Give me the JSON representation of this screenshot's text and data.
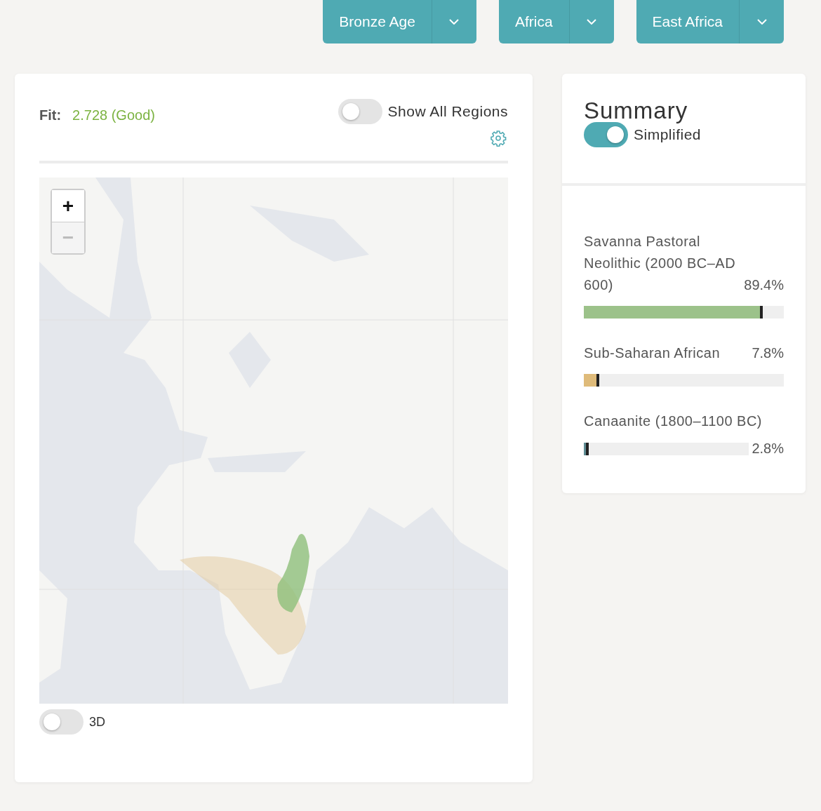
{
  "filters": [
    {
      "label": "Bronze Age"
    },
    {
      "label": "Africa"
    },
    {
      "label": "East Africa"
    }
  ],
  "fit": {
    "label": "Fit:",
    "value": "2.728 (Good)"
  },
  "show_all_regions": {
    "label": "Show All Regions",
    "on": false
  },
  "map": {
    "zoom_in": {
      "label": "+",
      "disabled": false
    },
    "zoom_out": {
      "label": "−",
      "disabled": true
    }
  },
  "toggle_3d": {
    "label": "3D",
    "on": false
  },
  "summary": {
    "title": "Summary",
    "simplified": {
      "label": "Simplified",
      "on": true
    },
    "components": [
      {
        "name": "Savanna Pastoral Neolithic (2000 BC–AD 600)",
        "percent": "89.4%",
        "level": 0.894,
        "color": "#9cc28a",
        "kind": "pct_on_label"
      },
      {
        "name": "Sub-Saharan African",
        "percent": "7.8%",
        "level": 0.078,
        "color": "#dfbb7a",
        "kind": "pct_on_label"
      },
      {
        "name": "Canaanite (1800–1100 BC)",
        "percent": "2.8%",
        "level": 0.028,
        "color": "#5f8d94",
        "kind": "pct_on_bar"
      }
    ]
  }
}
